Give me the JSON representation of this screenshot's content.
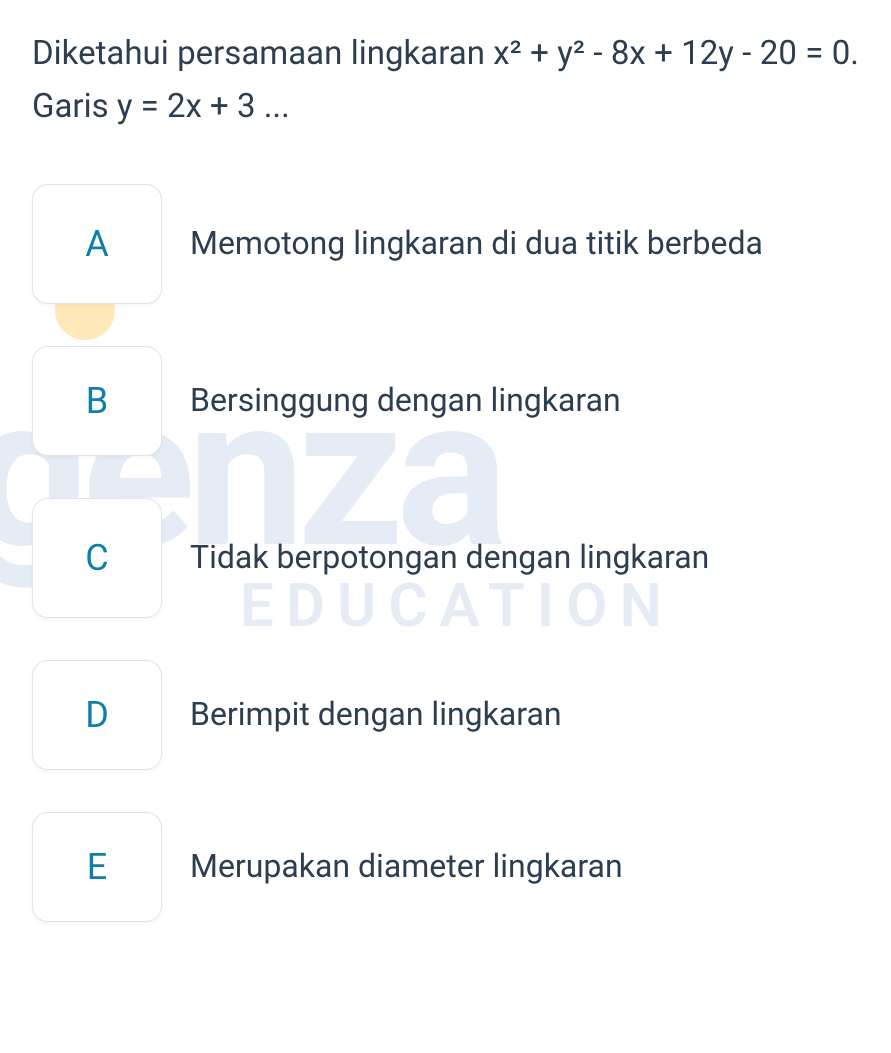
{
  "question": "Diketahui persamaan lingkaran x² + y² - 8x + 12y - 20 = 0. Garis y = 2x + 3 ...",
  "options": [
    {
      "letter": "A",
      "text": "Memotong lingkaran di dua titik berbeda"
    },
    {
      "letter": "B",
      "text": "Bersinggung dengan lingkaran"
    },
    {
      "letter": "C",
      "text": "Tidak berpotongan dengan lingkaran"
    },
    {
      "letter": "D",
      "text": "Berimpit dengan lingkaran"
    },
    {
      "letter": "E",
      "text": "Merupakan diameter lingkaran"
    }
  ],
  "watermark": {
    "main": "genza",
    "sub": "EDUCATION"
  }
}
